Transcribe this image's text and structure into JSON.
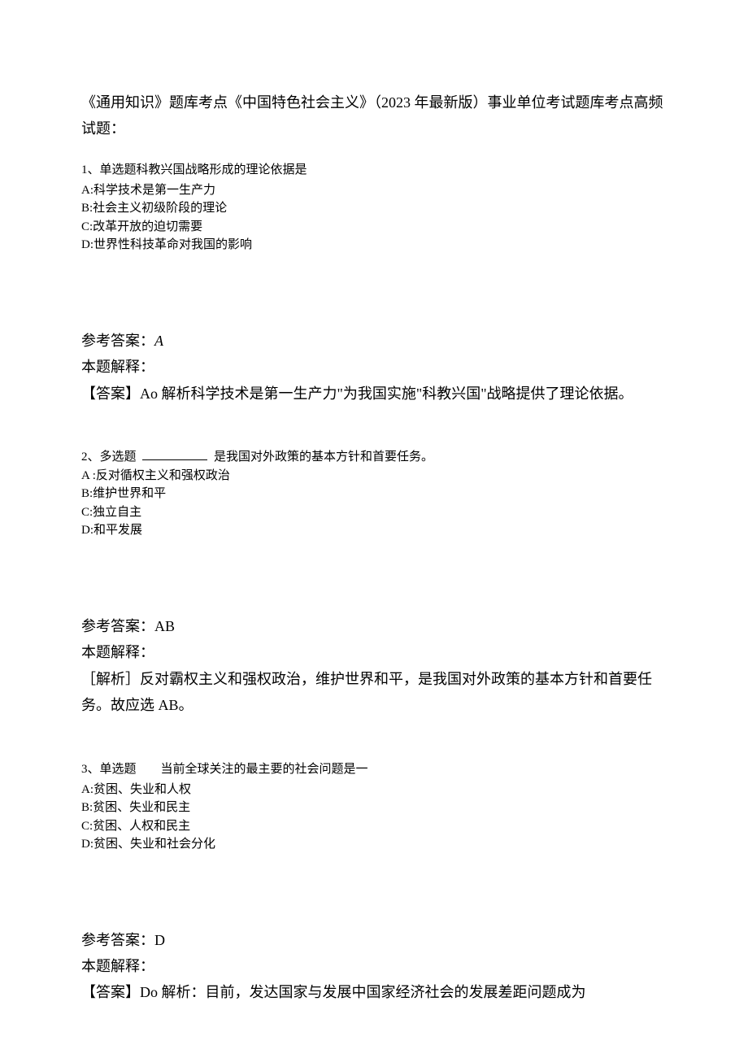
{
  "title": "《通用知识》题库考点《中国特色社会主义》（2023 年最新版）事业单位考试题库考点高频试题：",
  "q1": {
    "stem": "1、单选题科教兴国战略形成的理论依据是",
    "A": "A:科学技术是第一生产力",
    "B": "B:社会主义初级阶段的理论",
    "C": "C:改革开放的迫切需要",
    "D": "D:世界性科技革命对我国的影响"
  },
  "a1": {
    "ref_label": "参考答案：",
    "ref_value": "A",
    "exp_label": "本题解释：",
    "exp_text": "【答案】Ao 解析科学技术是第一生产力\"为我国实施\"科教兴国\"战略提供了理论依据。"
  },
  "q2": {
    "prefix": "2、多选题",
    "suffix": "是我国对外政策的基本方针和首要任务。",
    "A": "A :反对循权主义和强权政治",
    "B": "B:维护世界和平",
    "C": "C:独立自主",
    "D": "D:和平发展"
  },
  "a2": {
    "ref_label": "参考答案：",
    "ref_value": "AB",
    "exp_label": "本题解释：",
    "exp_text": "［解析］反对霸权主义和强权政治，维护世界和平，是我国对外政策的基本方针和首要任务。故应选 AB。"
  },
  "q3": {
    "stem": "3、单选题　　当前全球关注的最主要的社会问题是一",
    "A": "A:贫困、失业和人权",
    "B": "B:贫困、失业和民主",
    "C": "C:贫困、人权和民主",
    "D": "D:贫困、失业和社会分化"
  },
  "a3": {
    "ref_label": "参考答案：",
    "ref_value": "D",
    "exp_label": "本题解释：",
    "exp_text": "【答案】Do 解析：目前，发达国家与发展中国家经济社会的发展差距问题成为"
  }
}
